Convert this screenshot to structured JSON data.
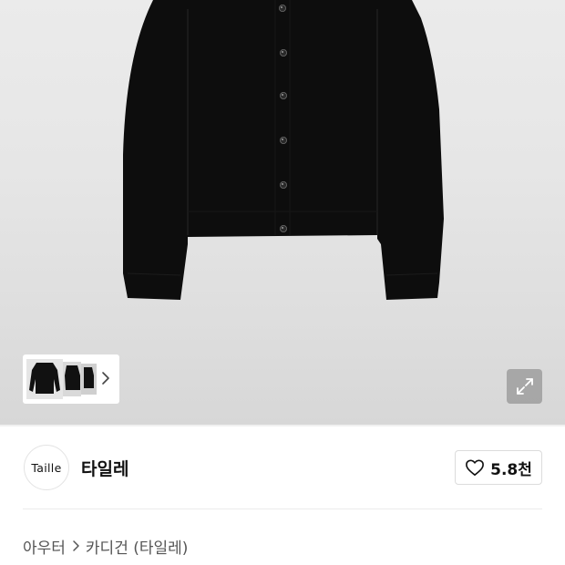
{
  "product_image": {
    "thumbnail_count": 3
  },
  "icons": {
    "thumbnail_next": "chevron-right-icon",
    "expand": "expand-arrows-icon",
    "like": "heart-outline-icon",
    "breadcrumb_separator": "chevron-right-icon"
  },
  "brand": {
    "logo_text": "Taille",
    "name": "타일레",
    "like_count": "5.8천"
  },
  "breadcrumb": {
    "category": "아우터",
    "subcategory": "카디건 (타일레)"
  },
  "colors": {
    "garment": "#0d0d0d",
    "image_background": "#e6e6e6",
    "text_primary": "#111111",
    "text_secondary": "#555555"
  }
}
